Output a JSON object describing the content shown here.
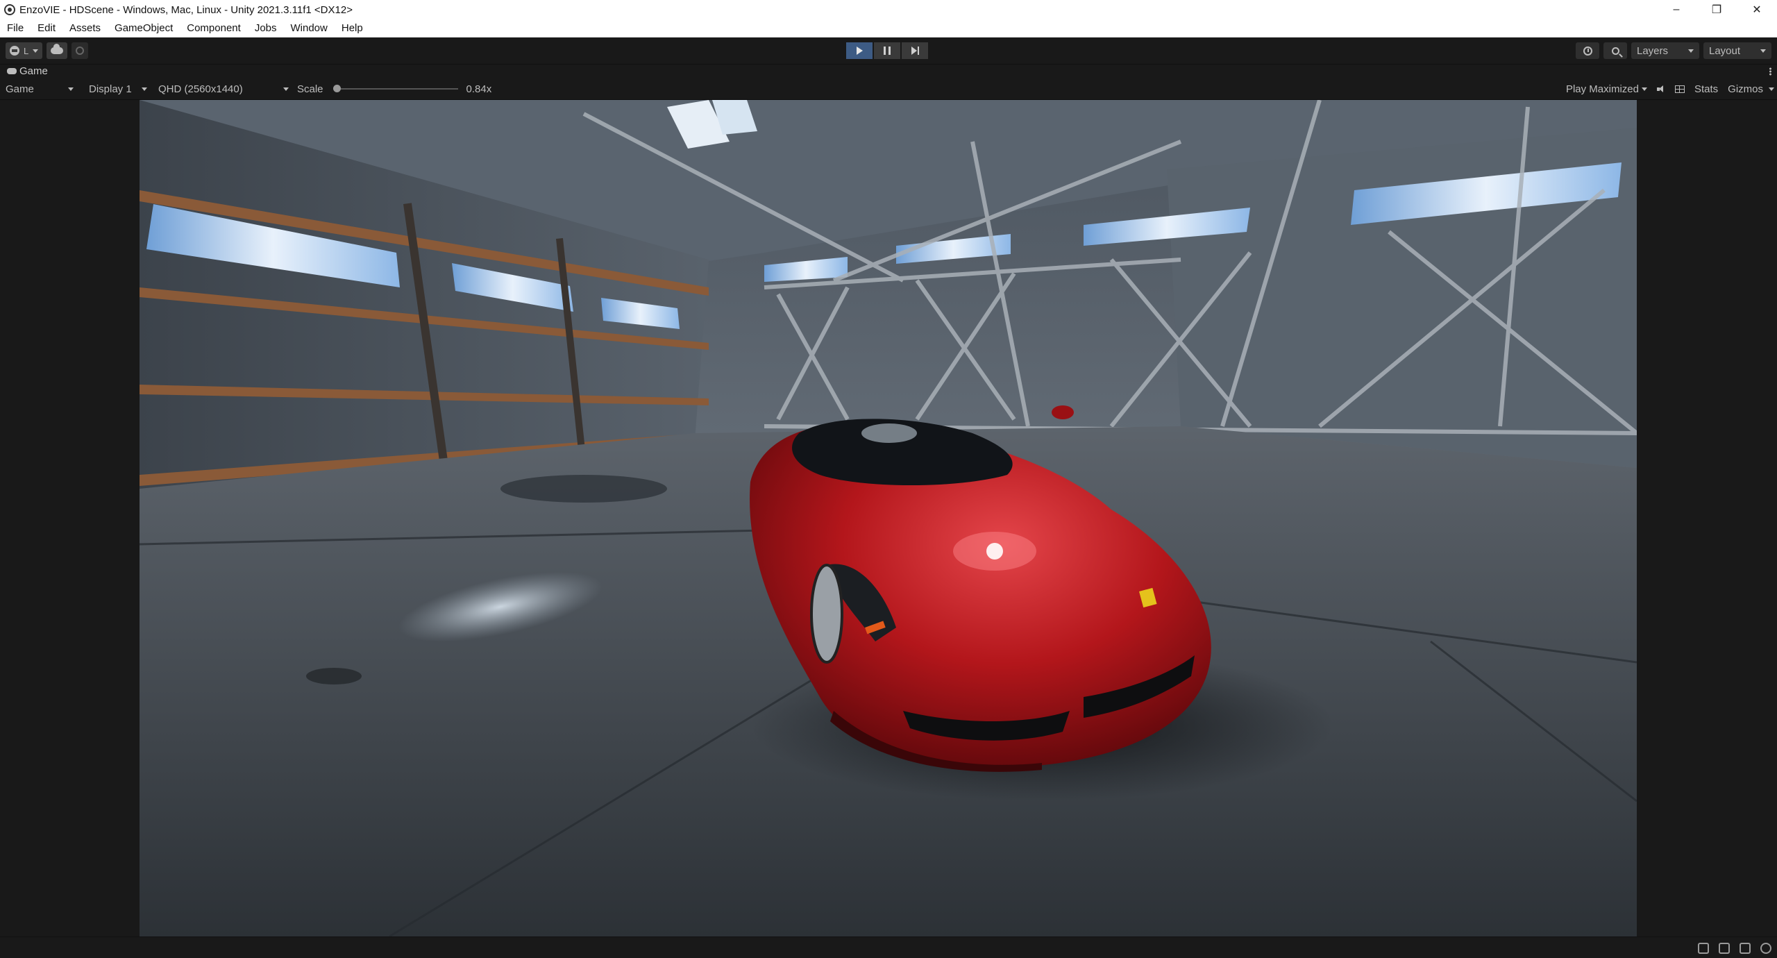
{
  "window": {
    "title": "EnzoVIE - HDScene - Windows, Mac, Linux - Unity 2021.3.11f1 <DX12>",
    "controls": [
      "–",
      "❐",
      "✕"
    ]
  },
  "menu": [
    "File",
    "Edit",
    "Assets",
    "GameObject",
    "Component",
    "Jobs",
    "Window",
    "Help"
  ],
  "toolbar": {
    "account_label": "L",
    "layers_label": "Layers",
    "layout_label": "Layout",
    "play_active": true
  },
  "tab": {
    "label": "Game"
  },
  "gamebar": {
    "view_select": "Game",
    "display_select": "Display 1",
    "resolution_select": "QHD (2560x1440)",
    "scale_label": "Scale",
    "scale_value": "0.84x",
    "play_mode_select": "Play Maximized",
    "stats_label": "Stats",
    "gizmos_label": "Gizmos"
  },
  "scene": {
    "description_icon": "car-render",
    "car_color": "#b3161b",
    "floor_color": "#4a5159",
    "wall_color": "#5c6670"
  }
}
